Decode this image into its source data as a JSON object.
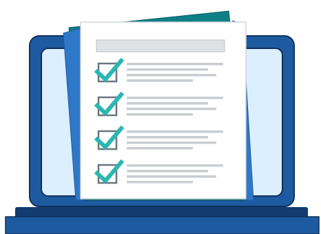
{
  "illustration": {
    "subject": "laptop-with-checklist",
    "checklist_items_visible": 4,
    "all_items_checked": true,
    "colors": {
      "laptop_frame": "#1e5aa0",
      "laptop_frame_outline": "#0f2f5a",
      "laptop_screen": "#dcefff",
      "laptop_base": "#1e5aa0",
      "laptop_base_dark": "#123c70",
      "paper_back_teal": "#0f7f86",
      "paper_back_blue": "#2e78c7",
      "paper_front": "#ffffff",
      "paper_outline": "#d0d5da",
      "header_bar": "#dfe2e5",
      "text_line": "#c9cdd1",
      "checkbox_border": "#6b7580",
      "checkmark": "#2bb7b1"
    }
  }
}
